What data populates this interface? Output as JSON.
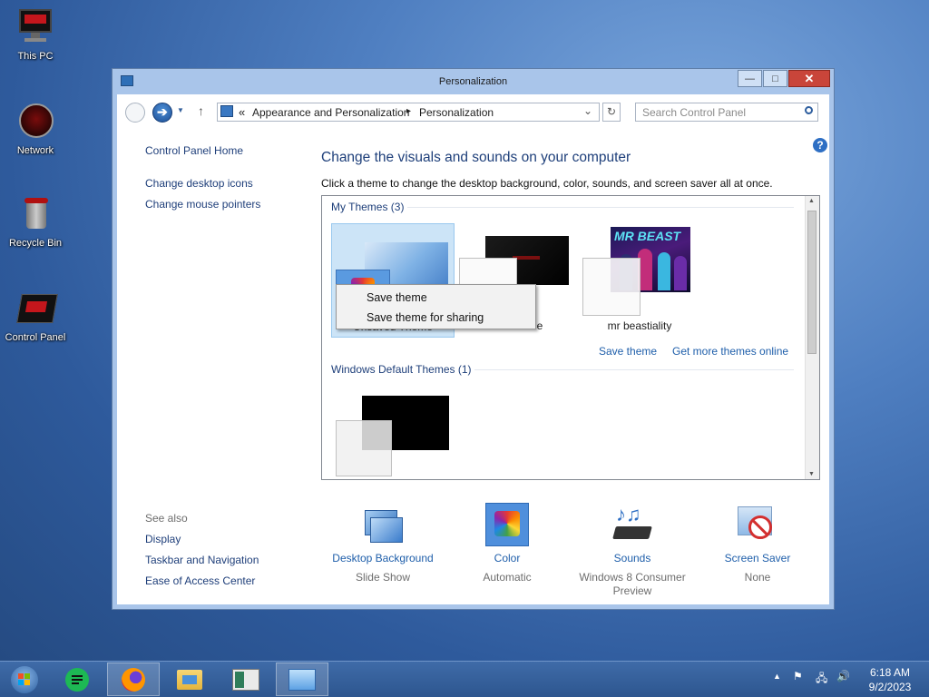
{
  "desktop": {
    "icons": [
      {
        "label": "This PC"
      },
      {
        "label": "Network"
      },
      {
        "label": "Recycle Bin"
      },
      {
        "label": "Control Panel"
      }
    ]
  },
  "window": {
    "title": "Personalization",
    "controls": {
      "minimize": "—",
      "maximize": "□",
      "close": "✕"
    }
  },
  "address": {
    "prefix": "«",
    "crumb1": "Appearance and Personalization",
    "separator": "▸",
    "crumb2": "Personalization"
  },
  "search": {
    "placeholder": "Search Control Panel"
  },
  "sidebar": {
    "home": "Control Panel Home",
    "links": [
      "Change desktop icons",
      "Change mouse pointers"
    ],
    "see_also_label": "See also",
    "see_also": [
      "Display",
      "Taskbar and Navigation",
      "Ease of Access Center"
    ]
  },
  "main": {
    "heading": "Change the visuals and sounds on your computer",
    "subheading": "Click a theme to change the desktop background, color, sounds, and screen saver all at once.",
    "my_themes_label": "My Themes (3)",
    "themes": [
      {
        "name": "Unsaved Theme"
      },
      {
        "name": "Black June"
      },
      {
        "name": "mr beastiality"
      }
    ],
    "mr_beast_art_text": "MR BEAST",
    "save_theme": "Save theme",
    "get_more": "Get more themes online",
    "default_themes_label": "Windows Default Themes (1)"
  },
  "context_menu": {
    "items": [
      "Save theme",
      "Save theme for sharing"
    ]
  },
  "bottom": [
    {
      "title": "Desktop Background",
      "value": "Slide Show"
    },
    {
      "title": "Color",
      "value": "Automatic"
    },
    {
      "title": "Sounds",
      "value": "Windows 8 Consumer Preview"
    },
    {
      "title": "Screen Saver",
      "value": "None"
    }
  ],
  "taskbar": {
    "time": "6:18 AM",
    "date": "9/2/2023"
  },
  "colors": {
    "link_blue": "#1e5eaa",
    "heading_blue": "#1e3f7a",
    "close_red": "#c9453a",
    "selection_blue": "#cce4f7"
  }
}
